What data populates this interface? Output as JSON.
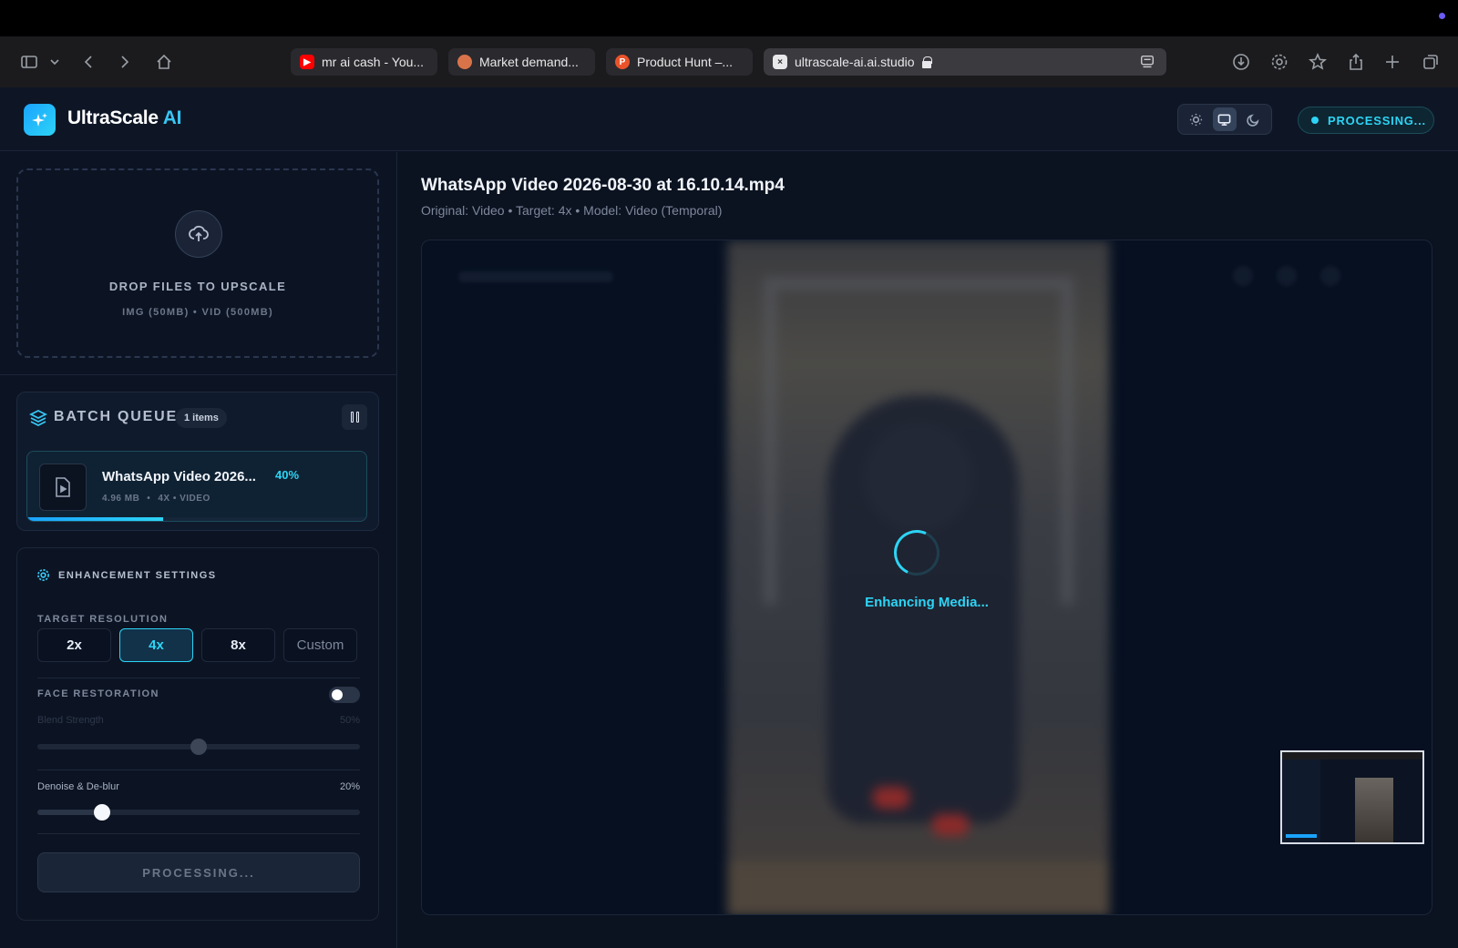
{
  "browser": {
    "tabs": [
      {
        "title": "mr ai cash - You...",
        "favicon_color": "#ff0000"
      },
      {
        "title": "Market demand...",
        "favicon_color": "#d9744a"
      },
      {
        "title": "Product Hunt –...",
        "favicon_color": "#ea532a",
        "favicon_letter": "P"
      },
      {
        "title": "ultrascale-ai.ai.studio",
        "favicon_color": "#e8e8ea",
        "active": true
      }
    ]
  },
  "header": {
    "brand": "UltraScale",
    "brand_accent": "AI",
    "status": "PROCESSING..."
  },
  "dropzone": {
    "title": "DROP FILES TO UPSCALE",
    "subtitle": "IMG (50MB) • VID (500MB)"
  },
  "queue": {
    "title": "BATCH QUEUE",
    "count": "1 items",
    "item": {
      "name": "WhatsApp Video 2026...",
      "progress_label": "40%",
      "progress": 0.4,
      "size": "4.96 MB",
      "sep": "•",
      "meta": "4X • VIDEO"
    }
  },
  "settings": {
    "title": "ENHANCEMENT SETTINGS",
    "target_label": "TARGET RESOLUTION",
    "resolutions": [
      "2x",
      "4x",
      "8x",
      "Custom"
    ],
    "selected_resolution": "4x",
    "face_label": "FACE RESTORATION",
    "face_enabled": false,
    "blend_label": "Blend Strength",
    "blend_value": "50%",
    "blend_level": 0.5,
    "denoise_label": "Denoise & De-blur",
    "denoise_value": "20%",
    "denoise_level": 0.2,
    "process_button": "PROCESSING..."
  },
  "main": {
    "file_title": "WhatsApp Video 2026-08-30 at 16.10.14.mp4",
    "file_sub": "Original: Video • Target: 4x • Model: Video (Temporal)",
    "status_text": "Enhancing Media..."
  },
  "colors": {
    "accent": "#2dd4f5",
    "background": "#0b1220"
  }
}
